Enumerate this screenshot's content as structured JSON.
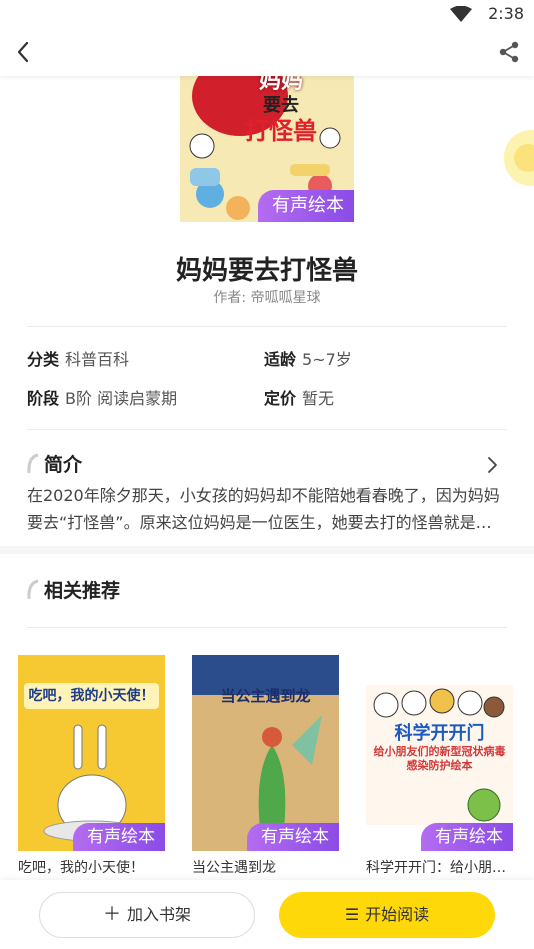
{
  "status_bar": {
    "time": "2:38",
    "wifi_icon": "wifi-icon"
  },
  "nav": {
    "back_icon": "chevron-left-icon",
    "share_icon": "share-icon"
  },
  "book": {
    "cover_title_lines": [
      "妈妈",
      "要去",
      "打怪兽"
    ],
    "badge": "有声绘本",
    "title": "妈妈要去打怪兽",
    "author": "作者: 帝呱呱星球",
    "meta": [
      {
        "label": "分类",
        "value": "科普百科"
      },
      {
        "label": "适龄",
        "value": "5~7岁"
      },
      {
        "label": "阶段",
        "value": "B阶 阅读启蒙期"
      },
      {
        "label": "定价",
        "value": "暂无"
      }
    ]
  },
  "intro": {
    "heading": "简介",
    "text": "在2020年除夕那天，小女孩的妈妈却不能陪她看春晚了，因为妈妈要去“打怪兽”。原来这位妈妈是一位医生，她要去打的怪兽就是…"
  },
  "recommend": {
    "heading": "相关推荐",
    "items": [
      {
        "cover_text": "吃吧，我的小天使！",
        "badge": "有声绘本",
        "name": "吃吧，我的小天使！"
      },
      {
        "cover_text": "当公主遇到龙",
        "badge": "有声绘本",
        "name": "当公主遇到龙"
      },
      {
        "cover_text": "科学开开门",
        "cover_subtext": "给小朋友们的新型冠状病毒感染防护绘本",
        "badge": "有声绘本",
        "name": "科学开开门：给小朋友们的新型冠状病毒感染防护绘本"
      }
    ]
  },
  "actions": {
    "add_shelf": "加入书架",
    "start_read": "开始阅读"
  },
  "colors": {
    "accent_yellow": "#ffd80a",
    "badge_purple": "#8a4ce6"
  }
}
